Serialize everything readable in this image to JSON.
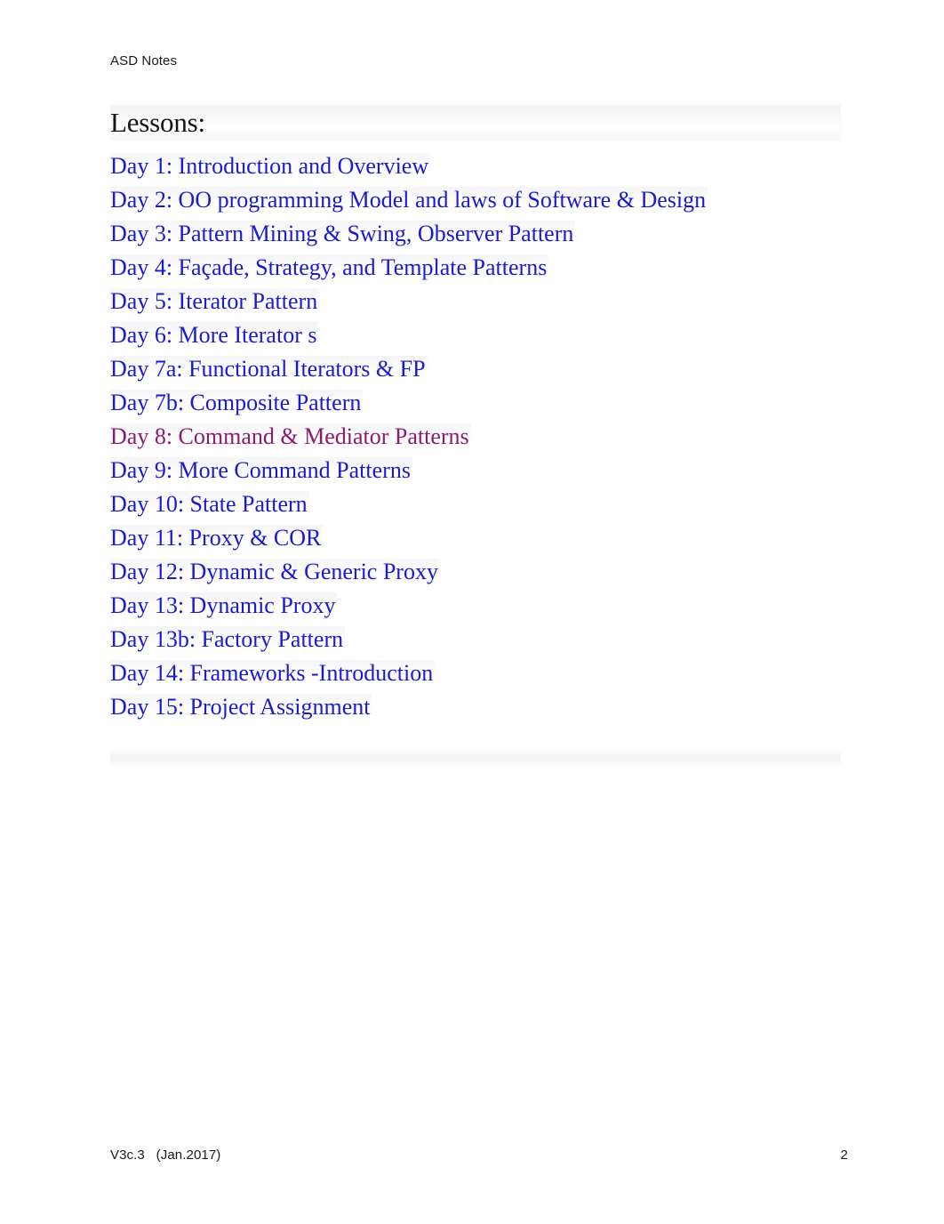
{
  "document": {
    "header_text": "ASD Notes",
    "title": "Lessons:",
    "link_color": "#1a1ad2",
    "visited_link_color": "#8e1a72"
  },
  "lessons": [
    {
      "label": "Day 1: Introduction and Overview",
      "state": "link"
    },
    {
      "label": "Day 2: OO programming Model and laws of Software & Design",
      "state": "link"
    },
    {
      "label": "Day 3: Pattern Mining & Swing, Observer Pattern",
      "state": "link"
    },
    {
      "label": "Day 4: Façade, Strategy, and Template Patterns",
      "state": "link"
    },
    {
      "label": "Day 5: Iterator Pattern",
      "state": "link"
    },
    {
      "label": "Day 6: More Iterator s",
      "state": "link"
    },
    {
      "label": "Day 7a: Functional Iterators & FP",
      "state": "link"
    },
    {
      "label": "Day 7b: Composite Pattern",
      "state": "link"
    },
    {
      "label": "Day 8: Command & Mediator Patterns",
      "state": "visited"
    },
    {
      "label": "Day 9: More Command Patterns",
      "state": "link"
    },
    {
      "label": "Day 10: State Pattern",
      "state": "link"
    },
    {
      "label": "Day 11: Proxy & COR",
      "state": "link"
    },
    {
      "label": "Day 12: Dynamic & Generic Proxy",
      "state": "link"
    },
    {
      "label": "Day 13: Dynamic Proxy",
      "state": "link"
    },
    {
      "label": "Day 13b: Factory Pattern",
      "state": "link"
    },
    {
      "label": "Day 14: Frameworks -Introduction",
      "state": "link"
    },
    {
      "label": "Day 15: Project Assignment",
      "state": "link"
    }
  ],
  "footer": {
    "version_text": "V3c.3   (Jan.2017)",
    "page_number": "2"
  }
}
